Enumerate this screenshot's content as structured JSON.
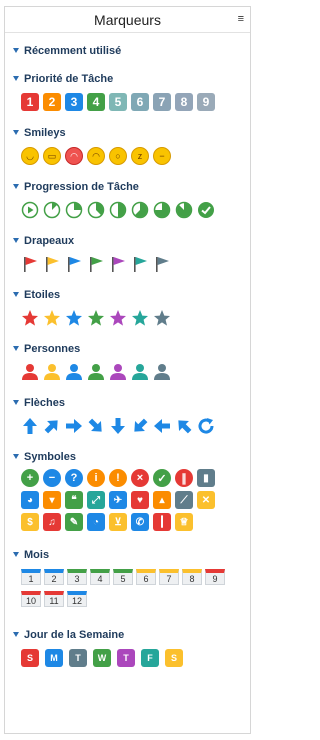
{
  "header": {
    "title": "Marqueurs",
    "menu_icon": "≡"
  },
  "sections": {
    "recent": {
      "title": "Récemment utilisé"
    },
    "priority": {
      "title": "Priorité de Tâche",
      "items": [
        "1",
        "2",
        "3",
        "4",
        "5",
        "6",
        "7",
        "8",
        "9"
      ]
    },
    "smileys": {
      "title": "Smileys"
    },
    "progress": {
      "title": "Progression de Tâche"
    },
    "flags": {
      "title": "Drapeaux"
    },
    "stars": {
      "title": "Etoiles"
    },
    "persons": {
      "title": "Personnes"
    },
    "arrows": {
      "title": "Flèches"
    },
    "symbols": {
      "title": "Symboles"
    },
    "months": {
      "title": "Mois",
      "items": [
        "1",
        "2",
        "3",
        "4",
        "5",
        "6",
        "7",
        "8",
        "9",
        "10",
        "11",
        "12"
      ]
    },
    "weekdays": {
      "title": "Jour de la Semaine",
      "items": [
        "S",
        "M",
        "T",
        "W",
        "T",
        "F",
        "S"
      ]
    }
  },
  "colors": {
    "priority": [
      "#e53935",
      "#fb8c00",
      "#1e88e5",
      "#43a047",
      "#7fb7b5",
      "#7fa8b5",
      "#8aa3b5",
      "#93a5b8",
      "#9aaab8"
    ],
    "markers": [
      "#e53935",
      "#fbc02d",
      "#1e88e5",
      "#43a047",
      "#ab47bc",
      "#26a69a",
      "#607d8b"
    ],
    "month_tabs": [
      "#1e88e5",
      "#1e88e5",
      "#43a047",
      "#43a047",
      "#43a047",
      "#fbc02d",
      "#fbc02d",
      "#fbc02d",
      "#e53935",
      "#e53935",
      "#e53935",
      "#1e88e5"
    ],
    "weekdays": [
      "#e53935",
      "#1e88e5",
      "#607d8b",
      "#43a047",
      "#ab47bc",
      "#26a69a",
      "#fbc02d"
    ]
  }
}
